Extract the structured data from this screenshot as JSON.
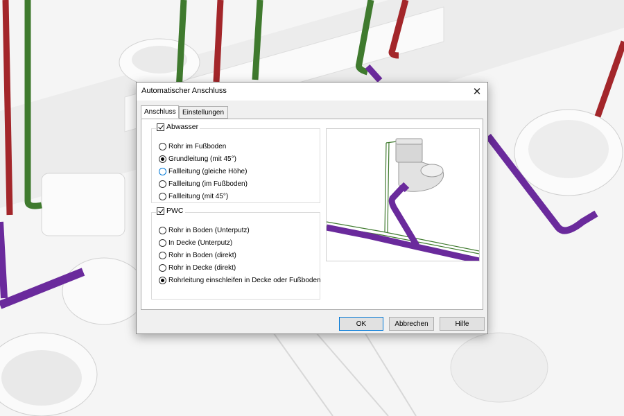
{
  "dialog": {
    "title": "Automatischer Anschluss",
    "close_icon": "close-icon"
  },
  "tabs": [
    {
      "label": "Anschluss",
      "active": true
    },
    {
      "label": "Einstellungen",
      "active": false
    }
  ],
  "groups": {
    "abwasser": {
      "label": "Abwasser",
      "checked": true,
      "options": [
        {
          "label": "Rohr im Fußboden",
          "selected": false
        },
        {
          "label": "Grundleitung (mit 45°)",
          "selected": true
        },
        {
          "label": "Fallleitung (gleiche Höhe)",
          "selected": false,
          "focused": true
        },
        {
          "label": "Fallleitung (im Fußboden)",
          "selected": false
        },
        {
          "label": "Fallleitung (mit 45°)",
          "selected": false
        }
      ]
    },
    "pwc": {
      "label": "PWC",
      "checked": true,
      "options": [
        {
          "label": "Rohr in Boden (Unterputz)",
          "selected": false
        },
        {
          "label": "In Decke (Unterputz)",
          "selected": false
        },
        {
          "label": "Rohr in Boden (direkt)",
          "selected": false
        },
        {
          "label": "Rohr in Decke (direkt)",
          "selected": false
        },
        {
          "label": "Rohrleitung einschleifen in Decke oder Fußboden",
          "selected": true
        }
      ]
    }
  },
  "buttons": {
    "ok": "OK",
    "cancel": "Abbrechen",
    "help": "Hilfe"
  },
  "colors": {
    "pipe_purple": "#6a2a9c",
    "pipe_green": "#3f7a2e",
    "pipe_red": "#a3262a",
    "accent_blue": "#0078d7"
  }
}
